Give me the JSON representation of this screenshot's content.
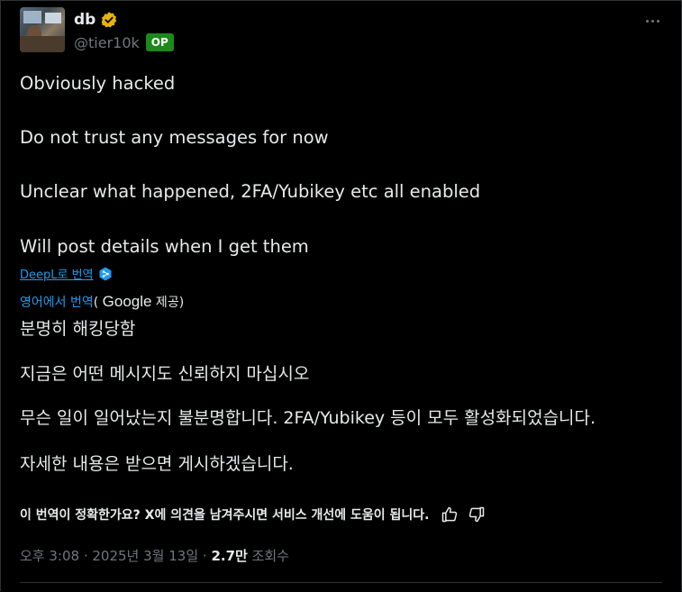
{
  "author": {
    "name": "db",
    "handle": "@tier10k",
    "badge": "OP",
    "verified_color": "#e7b40c"
  },
  "post": {
    "lines": [
      "Obviously hacked",
      "Do not trust any messages for now",
      "Unclear what happened, 2FA/Yubikey etc all enabled",
      "Will post details when I get them"
    ]
  },
  "deepl": {
    "link_label": "DeepL로 번역",
    "icon": "deepl-icon"
  },
  "google": {
    "link_label": "영어에서 번역",
    "paren_open": "( ",
    "brand": "Google",
    "suffix": " 제공)"
  },
  "translation": {
    "lines": [
      "분명히 해킹당함",
      "지금은 어떤 메시지도 신뢰하지 마십시오",
      "무슨 일이 일어났는지 불분명합니다. 2FA/Yubikey 등이 모두 활성화되었습니다.",
      "자세한 내용은 받으면 게시하겠습니다."
    ]
  },
  "feedback": {
    "prompt": "이 번역이 정확한가요? X에 의견을 남겨주시면 서비스 개선에 도움이 됩니다."
  },
  "meta": {
    "time": "오후 3:08",
    "sep1": " · ",
    "date": "2025년 3월 13일",
    "sep2": " · ",
    "views_count": "2.7만",
    "views_label": " 조회수"
  },
  "colors": {
    "background": "#000000",
    "text": "#e7e9ea",
    "secondary": "#71767b",
    "link": "#1d9bf0",
    "op_badge": "#1a8a1a"
  }
}
